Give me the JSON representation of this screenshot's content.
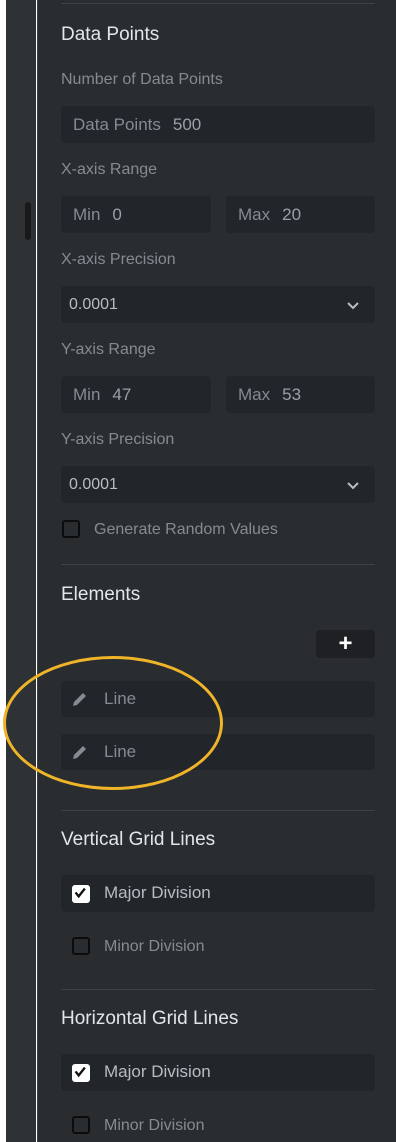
{
  "data_points": {
    "title": "Data Points",
    "count_label": "Number of Data Points",
    "count_field": {
      "label": "Data Points",
      "value": "500"
    },
    "x_range": {
      "label": "X-axis Range",
      "min_label": "Min",
      "min_value": "0",
      "max_label": "Max",
      "max_value": "20"
    },
    "x_precision": {
      "label": "X-axis Precision",
      "value": "0.0001"
    },
    "y_range": {
      "label": "Y-axis Range",
      "min_label": "Min",
      "min_value": "47",
      "max_label": "Max",
      "max_value": "53"
    },
    "y_precision": {
      "label": "Y-axis Precision",
      "value": "0.0001"
    },
    "random_values": {
      "label": "Generate Random Values",
      "checked": false
    }
  },
  "elements": {
    "title": "Elements",
    "add_label": "+",
    "items": [
      {
        "label": "Line",
        "icon": "pencil-icon"
      },
      {
        "label": "Line",
        "icon": "pencil-icon"
      }
    ],
    "highlight_color": "#f0b429"
  },
  "vertical_grid": {
    "title": "Vertical Grid Lines",
    "major": {
      "label": "Major Division",
      "checked": true
    },
    "minor": {
      "label": "Minor Division",
      "checked": false
    }
  },
  "horizontal_grid": {
    "title": "Horizontal Grid Lines",
    "major": {
      "label": "Major Division",
      "checked": true
    },
    "minor": {
      "label": "Minor Division",
      "checked": false
    }
  }
}
